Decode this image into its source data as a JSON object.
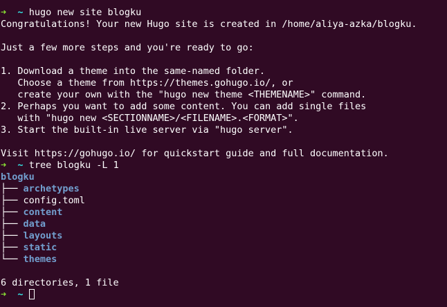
{
  "prompt": {
    "arrow": "➜",
    "dir": "~"
  },
  "cmd1": "hugo new site blogku",
  "out1": [
    "Congratulations! Your new Hugo site is created in /home/aliya-azka/blogku.",
    "",
    "Just a few more steps and you're ready to go:",
    "",
    "1. Download a theme into the same-named folder.",
    "   Choose a theme from https://themes.gohugo.io/, or",
    "   create your own with the \"hugo new theme <THEMENAME>\" command.",
    "2. Perhaps you want to add some content. You can add single files",
    "   with \"hugo new <SECTIONNAME>/<FILENAME>.<FORMAT>\".",
    "3. Start the built-in live server via \"hugo server\".",
    "",
    "Visit https://gohugo.io/ for quickstart guide and full documentation."
  ],
  "cmd2": "tree blogku -L 1",
  "tree": {
    "root": "blogku",
    "entries": [
      {
        "branch": "├── ",
        "name": "archetypes"
      },
      {
        "branch": "├── ",
        "name": "config.toml"
      },
      {
        "branch": "├── ",
        "name": "content"
      },
      {
        "branch": "├── ",
        "name": "data"
      },
      {
        "branch": "├── ",
        "name": "layouts"
      },
      {
        "branch": "├── ",
        "name": "static"
      },
      {
        "branch": "└── ",
        "name": "themes"
      }
    ]
  },
  "summary": "6 directories, 1 file"
}
